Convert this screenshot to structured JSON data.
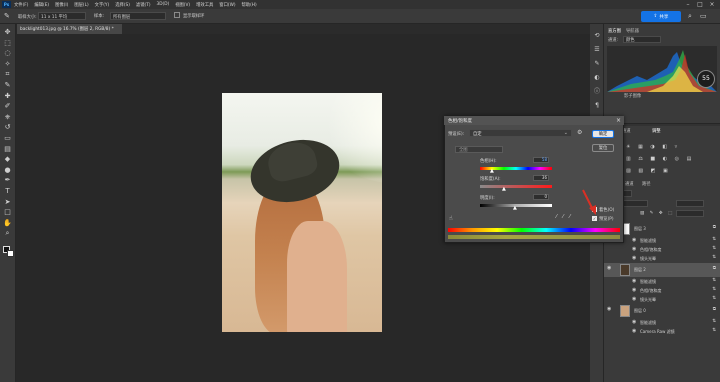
{
  "menubar": {
    "logo": "Ps",
    "items": [
      "文件(F)",
      "编辑(E)",
      "图像(I)",
      "图层(L)",
      "文字(Y)",
      "选择(S)",
      "滤镜(T)",
      "3D(D)",
      "视图(V)",
      "增效工具",
      "窗口(W)",
      "帮助(H)"
    ]
  },
  "optionsbar": {
    "sample_size_label": "取样大小:",
    "sample_size_value": "11 x 11 平均",
    "sample_mode": "所有图层",
    "show_ring": "显示取样环",
    "share_label": "共享"
  },
  "document": {
    "tab_title": "backlight013.jpg @ 16.7% (图层 2, RGB/8) *"
  },
  "histogram": {
    "tabs": [
      "直方图",
      "导航器"
    ],
    "channel_label": "通道:",
    "channel_value": "颜色",
    "badge": "55",
    "sublabel": "影子图像"
  },
  "layers": {
    "tabs": [
      "图层",
      "通道",
      "路径"
    ],
    "rows": [
      {
        "name": "图层 3",
        "type": "layer"
      },
      {
        "name": "智能滤镜",
        "type": "sub"
      },
      {
        "name": "色相/饱和度",
        "type": "sub"
      },
      {
        "name": "镜头光晕",
        "type": "sub"
      },
      {
        "name": "图层 2",
        "type": "layer"
      },
      {
        "name": "智能滤镜",
        "type": "sub"
      },
      {
        "name": "色相/饱和度",
        "type": "sub"
      },
      {
        "name": "镜头光晕",
        "type": "sub"
      },
      {
        "name": "图层 0",
        "type": "layer"
      },
      {
        "name": "智能滤镜",
        "type": "sub"
      },
      {
        "name": "Camera Raw 滤镜",
        "type": "sub"
      }
    ]
  },
  "dialog": {
    "title": "色相/饱和度",
    "preset_label": "预设(E):",
    "preset_value": "自定",
    "channel_value": "全图",
    "hue_label": "色相(H):",
    "hue_value": "58",
    "saturation_label": "饱和度(A):",
    "saturation_value": "36",
    "lightness_label": "明度(I):",
    "lightness_value": "0",
    "ok_label": "确定",
    "reset_label": "复位",
    "colorize_label": "着色(O)",
    "preview_label": "预览(P)"
  },
  "colors": {
    "accent": "#1473e6",
    "dialog_bg": "#4b4b4b",
    "app_bg": "#282828",
    "arrow": "#d93025"
  },
  "tools": [
    "move-icon",
    "marquee-icon",
    "lasso-icon",
    "magic-wand-icon",
    "crop-icon",
    "eyedropper-icon",
    "healing-icon",
    "brush-icon",
    "clone-stamp-icon",
    "history-brush-icon",
    "eraser-icon",
    "gradient-icon",
    "blur-icon",
    "dodge-icon",
    "pen-icon",
    "type-icon",
    "path-select-icon",
    "shape-icon",
    "hand-icon",
    "zoom-icon"
  ]
}
